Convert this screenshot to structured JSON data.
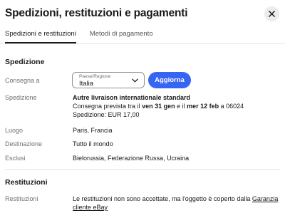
{
  "header": {
    "title": "Spedizioni, restituzioni e pagamenti"
  },
  "icons": {
    "close": "close-icon",
    "chevron": "chevron-down-icon"
  },
  "tabs": [
    {
      "label": "Spedizioni e restituzioni",
      "active": true
    },
    {
      "label": "Metodi di pagamento",
      "active": false
    }
  ],
  "shipping": {
    "section_title": "Spedizione",
    "deliver_to_label": "Consegna a",
    "country_select": {
      "caption": "Paese/Regione",
      "value": "Italia"
    },
    "update_button": "Aggiorna",
    "service_label": "Spedizione",
    "service_name": "Autre livraison internationale standard",
    "delivery_prefix": "Consegna prevista tra il ",
    "delivery_start": "ven 31 gen",
    "delivery_middle": " e il ",
    "delivery_end": "mer 12 feb",
    "delivery_suffix": " a 06024",
    "cost": "Spedizione: EUR 17,00",
    "location_label": "Luogo",
    "location_value": "Paris, Francia",
    "destination_label": "Destinazione",
    "destination_value": "Tutto il mondo",
    "excluded_label": "Esclusi",
    "excluded_value": "Bielorussia, Federazione Russa, Ucraina"
  },
  "returns": {
    "section_title": "Restituzioni",
    "label": "Restituzioni",
    "text": "Le restituzioni non sono accettate, ma l'oggetto è coperto dalla ",
    "link": "Garanzia cliente eBay"
  },
  "colors": {
    "accent": "#3665f3",
    "text": "#191919",
    "muted": "#707070"
  }
}
